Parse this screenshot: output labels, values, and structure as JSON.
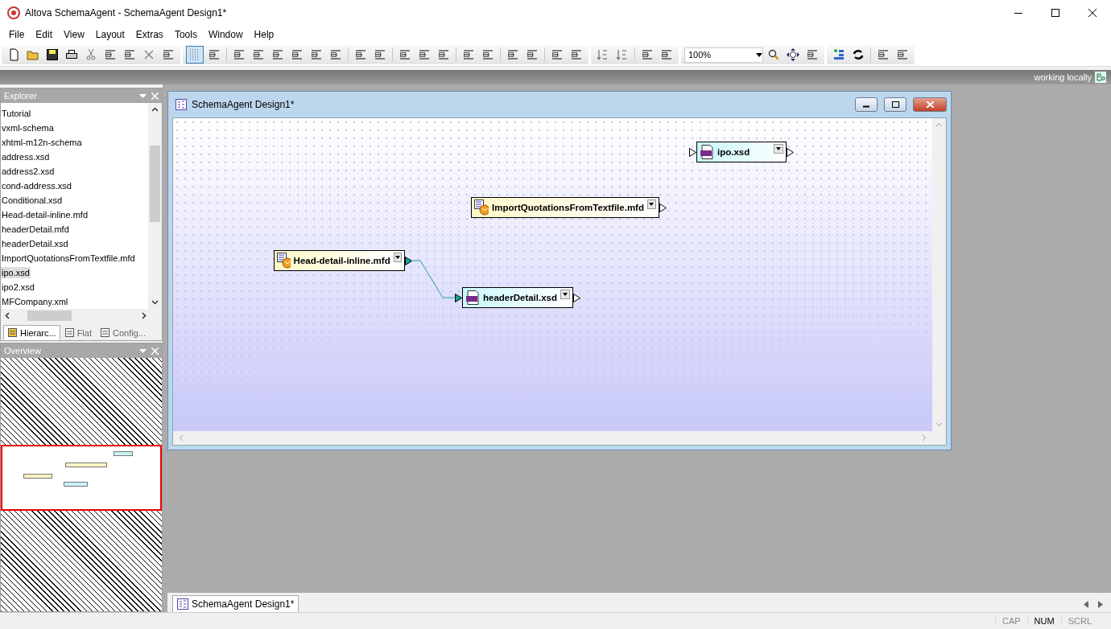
{
  "window": {
    "title": "Altova SchemaAgent - SchemaAgent Design1*"
  },
  "menu": [
    "File",
    "Edit",
    "View",
    "Layout",
    "Extras",
    "Tools",
    "Window",
    "Help"
  ],
  "toolbar": {
    "grid_pressed": true,
    "zoom": "100%"
  },
  "connection_status": "working locally",
  "explorer": {
    "title": "Explorer",
    "items": [
      {
        "label": "Tutorial",
        "selected": false
      },
      {
        "label": "vxml-schema",
        "selected": false
      },
      {
        "label": "xhtml-m12n-schema",
        "selected": false
      },
      {
        "label": "address.xsd",
        "selected": false
      },
      {
        "label": "address2.xsd",
        "selected": false
      },
      {
        "label": "cond-address.xsd",
        "selected": false
      },
      {
        "label": "Conditional.xsd",
        "selected": false
      },
      {
        "label": "Head-detail-inline.mfd",
        "selected": false
      },
      {
        "label": "headerDetail.mfd",
        "selected": false
      },
      {
        "label": "headerDetail.xsd",
        "selected": false
      },
      {
        "label": "ImportQuotationsFromTextfile.mfd",
        "selected": false
      },
      {
        "label": "ipo.xsd",
        "selected": true
      },
      {
        "label": "ipo2.xsd",
        "selected": false
      },
      {
        "label": "MFCompany.xml",
        "selected": false
      }
    ],
    "tabs": [
      {
        "label": "Hierarc...",
        "selected": true
      },
      {
        "label": "Flat",
        "selected": false
      },
      {
        "label": "Config...",
        "selected": false
      }
    ]
  },
  "overview": {
    "title": "Overview"
  },
  "design_window": {
    "title": "SchemaAgent Design1*",
    "nodes": [
      {
        "label": "ipo.xsd",
        "kind": "xsd",
        "has_input": true,
        "input_linked": false,
        "output_linked": false
      },
      {
        "label": "ImportQuotationsFromTextfile.mfd",
        "kind": "mfd",
        "has_input": false,
        "output_linked": false
      },
      {
        "label": "Head-detail-inline.mfd",
        "kind": "mfd",
        "has_input": false,
        "output_linked": true
      },
      {
        "label": "headerDetail.xsd",
        "kind": "xsd",
        "has_input": true,
        "input_linked": true,
        "output_linked": false
      }
    ]
  },
  "document_tabs": [
    {
      "label": "SchemaAgent Design1*",
      "selected": true
    }
  ],
  "status_bar": [
    {
      "label": "CAP",
      "on": false
    },
    {
      "label": "NUM",
      "on": true
    },
    {
      "label": "SCRL",
      "on": false
    }
  ]
}
